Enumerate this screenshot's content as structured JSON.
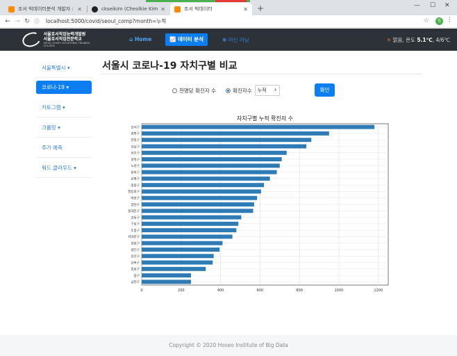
{
  "browser": {
    "tabs": [
      {
        "title": "조서 빅데이터분석 개발자 : 메이",
        "favicon_color": "#ff8a00",
        "active": false
      },
      {
        "title": "ckseikim (Cheolkie Kim)",
        "favicon_color": "#222222",
        "active": false
      },
      {
        "title": "조서 빅데이터",
        "favicon_color": "#ff8a00",
        "active": true
      }
    ],
    "url": "localhost:5000/covid/seoul_comp?month=누적",
    "profile_initials": "임"
  },
  "navbar": {
    "logo_line1": "서울호서직업능력개발원",
    "logo_line2": "서울호서직업전문학교",
    "logo_sub": "SEOUL HOSEO VOCATIONAL TRAINING COLLEGE",
    "home": "Home",
    "data_analysis": "데이터 분석",
    "ml": "머신 러닝",
    "weather_text": "맑음, 온도",
    "weather_temp": "5.1℃",
    "weather_range": "4/6℃"
  },
  "sidebar": {
    "items": [
      {
        "label": "서울특별시 ▾"
      },
      {
        "label": "코로나-19 ▾"
      },
      {
        "label": "카토그램 ▾"
      },
      {
        "label": "크롤링 ▾"
      },
      {
        "label": "주가 예측"
      },
      {
        "label": "워드 클라우드 ▾"
      }
    ]
  },
  "main": {
    "title": "서울시 코로나-19 자치구별 비교",
    "option1": "천명당 확진자 수",
    "option2": "확진자수",
    "select_value": "누적",
    "confirm": "확인"
  },
  "chart_data": {
    "type": "bar",
    "orientation": "horizontal",
    "title": "자치구별 누적 확진자 수",
    "bar_color": "#2e7bb5",
    "xlim": [
      0,
      1250
    ],
    "xticks": [
      0,
      200,
      400,
      600,
      800,
      1000,
      1200
    ],
    "grid": true,
    "categories": [
      "강서구",
      "송파구",
      "관악구",
      "강남구",
      "서초구",
      "성북구",
      "노원구",
      "동작구",
      "은평구",
      "중랑구",
      "영등포구",
      "마포구",
      "양천구",
      "동대문구",
      "강동구",
      "구로구",
      "도봉구",
      "서대문구",
      "성동구",
      "광진구",
      "용산구",
      "강북구",
      "종로구",
      "중구",
      "금천구"
    ],
    "values": [
      1180,
      950,
      860,
      835,
      735,
      710,
      700,
      685,
      650,
      620,
      605,
      585,
      570,
      565,
      505,
      490,
      480,
      460,
      410,
      395,
      365,
      360,
      325,
      250,
      250
    ]
  },
  "footer": {
    "text": "Copyright © 2020 Hoseo Institute of Big Data"
  }
}
